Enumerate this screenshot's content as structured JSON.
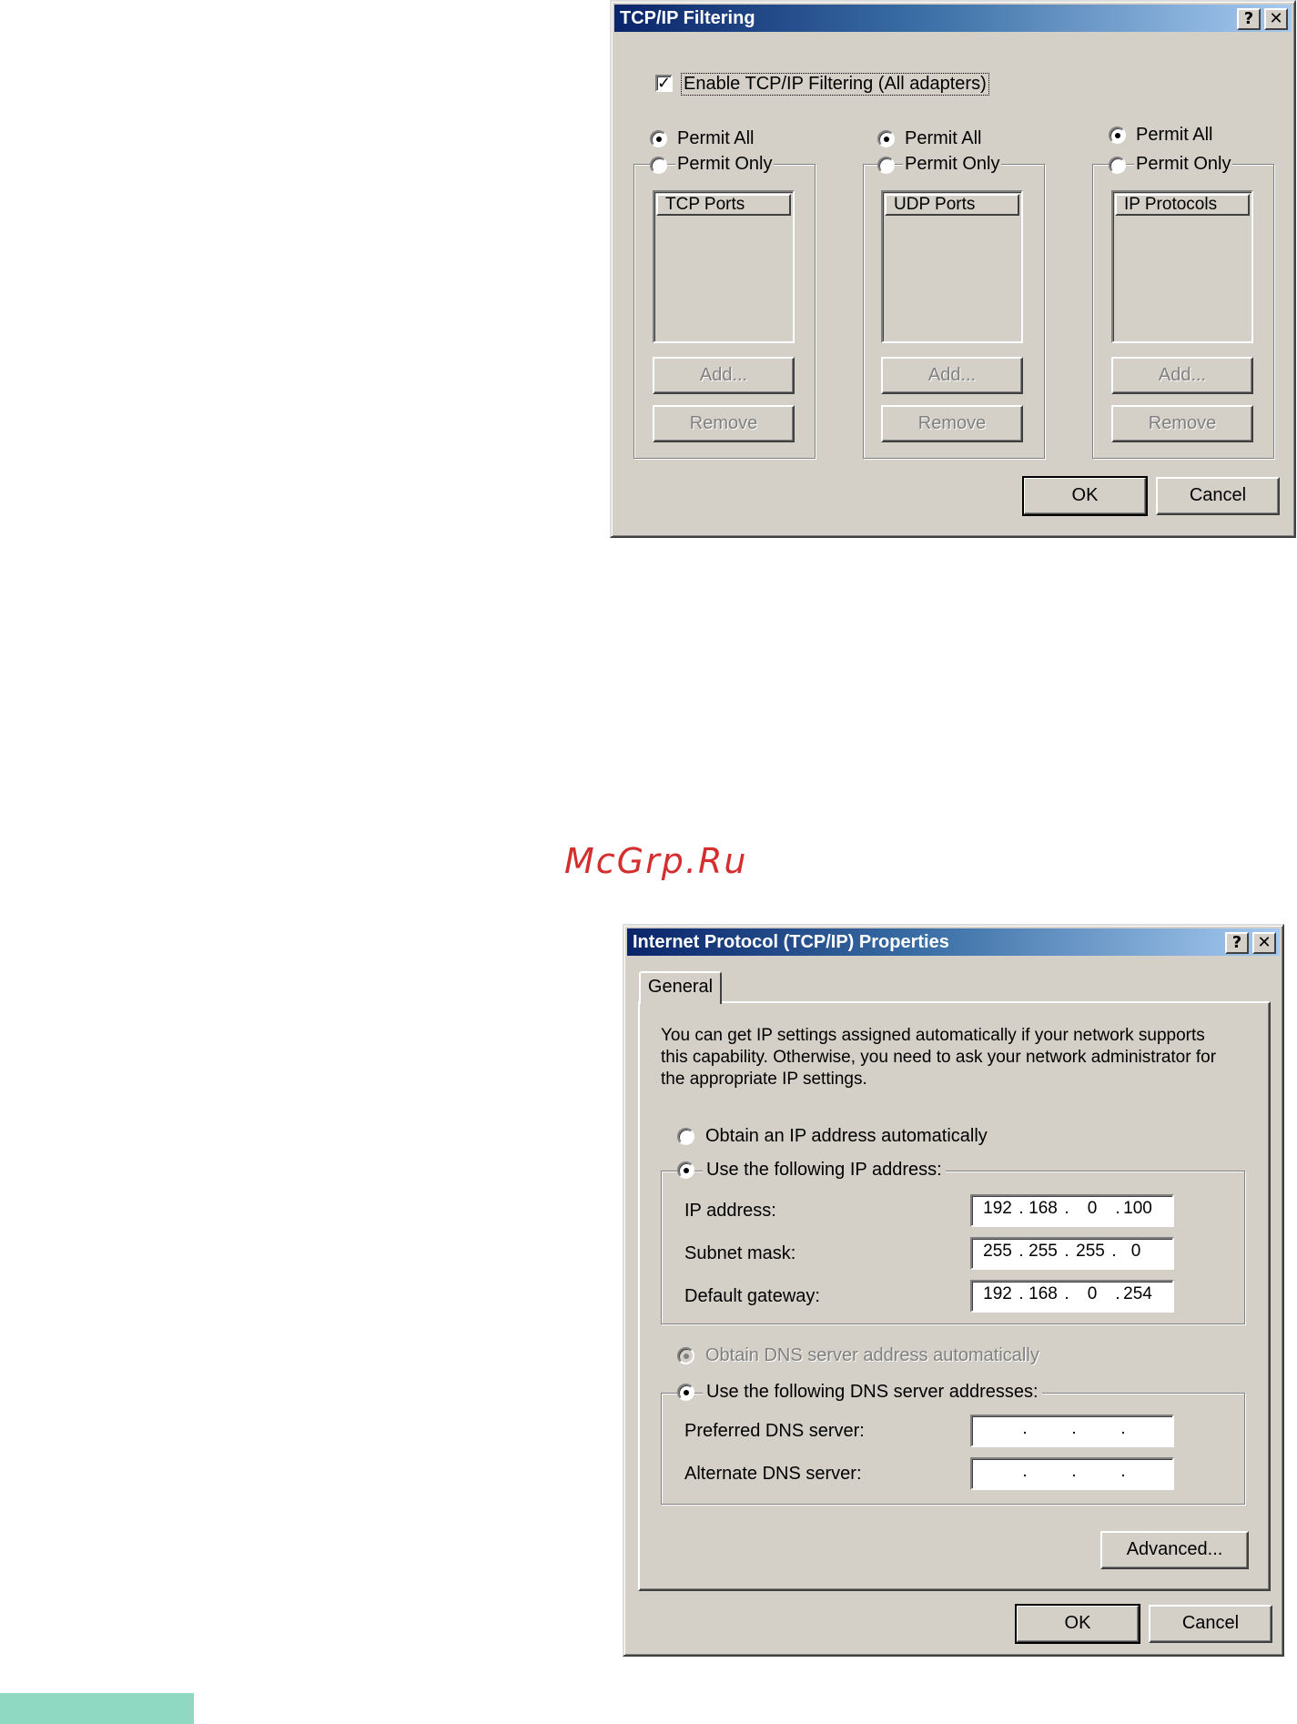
{
  "watermark": "McGrp.Ru",
  "filtering": {
    "title": "TCP/IP Filtering",
    "help_glyph": "?",
    "close_glyph": "✕",
    "enable_checked": true,
    "enable_label": "Enable TCP/IP Filtering (All adapters)",
    "columns": [
      {
        "permit_all": "Permit All",
        "permit_only": "Permit Only",
        "list_header": "TCP Ports",
        "add": "Add...",
        "remove": "Remove"
      },
      {
        "permit_all": "Permit All",
        "permit_only": "Permit Only",
        "list_header": "UDP Ports",
        "add": "Add...",
        "remove": "Remove"
      },
      {
        "permit_all": "Permit All",
        "permit_only": "Permit Only",
        "list_header": "IP Protocols",
        "add": "Add...",
        "remove": "Remove"
      }
    ],
    "ok": "OK",
    "cancel": "Cancel"
  },
  "properties": {
    "title": "Internet Protocol (TCP/IP) Properties",
    "help_glyph": "?",
    "close_glyph": "✕",
    "tab_general": "General",
    "description_lines": [
      "You can get IP settings assigned automatically if your network supports",
      "this capability. Otherwise, you need to ask your network administrator for",
      "the appropriate IP settings."
    ],
    "obtain_ip_auto": "Obtain an IP address automatically",
    "use_following_ip": "Use the following IP address:",
    "ip_address_label": "IP address:",
    "ip_address": [
      "192",
      "168",
      "0",
      "100"
    ],
    "subnet_mask_label": "Subnet mask:",
    "subnet_mask": [
      "255",
      "255",
      "255",
      "0"
    ],
    "default_gateway_label": "Default gateway:",
    "default_gateway": [
      "192",
      "168",
      "0",
      "254"
    ],
    "obtain_dns_auto": "Obtain DNS server address automatically",
    "use_following_dns": "Use the following DNS server addresses:",
    "preferred_dns_label": "Preferred DNS server:",
    "preferred_dns": [
      "",
      "",
      "",
      ""
    ],
    "alternate_dns_label": "Alternate DNS server:",
    "alternate_dns": [
      "",
      "",
      "",
      ""
    ],
    "dot": ".",
    "advanced": "Advanced...",
    "ok": "OK",
    "cancel": "Cancel"
  }
}
